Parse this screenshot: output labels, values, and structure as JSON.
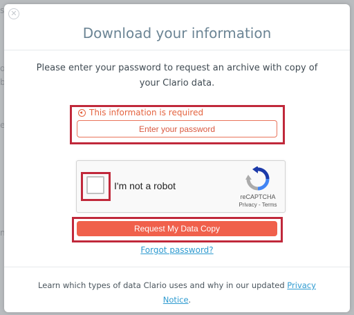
{
  "background": {
    "fragments": [
      "s",
      "o",
      "b",
      "e",
      "n"
    ]
  },
  "modal": {
    "close_icon": "close-circle-icon",
    "title": "Download your information",
    "instructions": "Please enter your password to request an archive with copy of your Clario data.",
    "error_message": "This information is required",
    "password": {
      "placeholder": "Enter your password",
      "value": ""
    },
    "captcha": {
      "label": "I'm not a robot",
      "brand": "reCAPTCHA",
      "privacy": "Privacy",
      "separator": "-",
      "terms": "Terms",
      "checked": false
    },
    "request_button": "Request My Data Copy",
    "forgot_password": "Forgot password?",
    "footer": {
      "text": "Learn which types of data Clario uses and why in our updated",
      "link": "Privacy Notice",
      "end": "."
    }
  },
  "colors": {
    "accent": "#f0604b",
    "error": "#e4633f",
    "link": "#2d9ad0",
    "title": "#6b8494",
    "highlight": "#c0283a"
  }
}
